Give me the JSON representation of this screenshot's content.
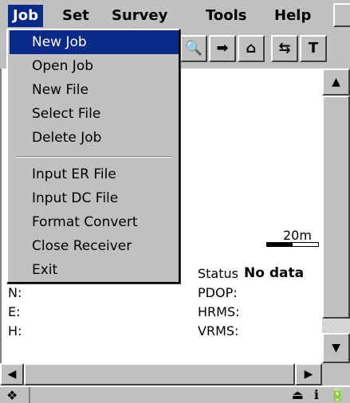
{
  "menubar": {
    "items": [
      {
        "label": "Job",
        "active": true
      },
      {
        "label": "Set",
        "active": false
      },
      {
        "label": "Survey",
        "active": false
      },
      {
        "label": "Tools",
        "active": false
      },
      {
        "label": "Help",
        "active": false
      }
    ]
  },
  "toolbar": {
    "buttons": [
      {
        "glyph": "🔍",
        "icon": "zoom-icon"
      },
      {
        "glyph": "➡",
        "icon": "arrow-right-icon"
      },
      {
        "glyph": "⌂",
        "icon": "home-icon"
      },
      {
        "glyph": "⇆",
        "icon": "layers-icon"
      },
      {
        "glyph": "T",
        "icon": "text-tool-icon"
      }
    ]
  },
  "job_menu": {
    "items": [
      {
        "label": "New Job",
        "selected": true
      },
      {
        "label": "Open Job"
      },
      {
        "label": "New  File"
      },
      {
        "label": "Select File"
      },
      {
        "label": "Delete Job"
      },
      {
        "label": "Input ER File"
      },
      {
        "label": "Input DC File"
      },
      {
        "label": "Format Convert"
      },
      {
        "label": "Close Receiver"
      },
      {
        "label": "Exit"
      }
    ]
  },
  "map": {
    "scale_label": "20m"
  },
  "status": {
    "status_label": "Status",
    "status_value": "No data",
    "n_label": "N:",
    "e_label": "E:",
    "h_label": "H:",
    "pdop_label": "PDOP:",
    "hrms_label": "HRMS:",
    "vrms_label": "VRMS:"
  },
  "scrollbars": {
    "up": "▲",
    "down": "▼",
    "left": "◀",
    "right": "▶"
  },
  "taskbar": {
    "start_glyph": "❖",
    "tray_glyphs": [
      "⏏",
      "ℹ",
      "🔋"
    ]
  },
  "colors": {
    "menu_highlight": "#0a2a8a",
    "chrome": "#c0c0c0"
  }
}
